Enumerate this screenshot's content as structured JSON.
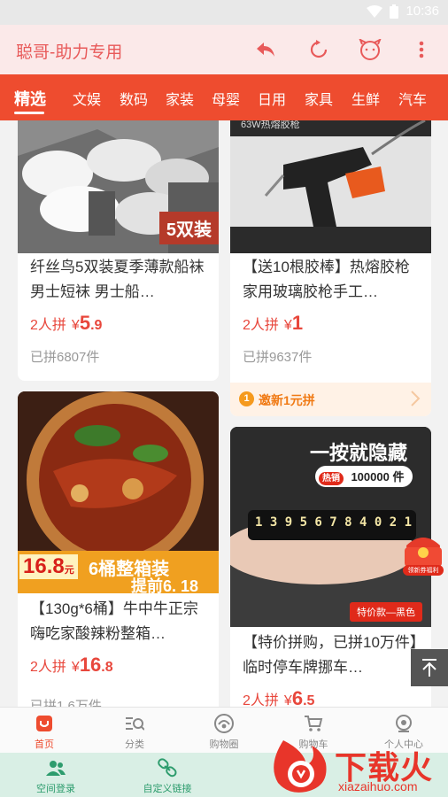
{
  "status_bar": {
    "time": "10:36"
  },
  "app_bar": {
    "title": "聪哥-助力专用"
  },
  "tabs": [
    {
      "label": "精选"
    },
    {
      "label": "文娱"
    },
    {
      "label": "数码"
    },
    {
      "label": "家装"
    },
    {
      "label": "母婴"
    },
    {
      "label": "日用"
    },
    {
      "label": "家具"
    },
    {
      "label": "生鲜"
    },
    {
      "label": "汽车"
    }
  ],
  "products": [
    {
      "image_badge": "5双装",
      "name": "纤丝鸟5双装夏季薄款船袜男士短袜 男士船…",
      "group": "2人拼",
      "currency": "¥",
      "price_int": "5",
      "price_dec": ".9",
      "sold": "已拼6807件"
    },
    {
      "image_caption": "63W热熔胶枪",
      "name": "【送10根胶棒】热熔胶枪家用玻璃胶枪手工…",
      "group": "2人拼",
      "currency": "¥",
      "price_int": "1",
      "price_dec": "",
      "sold": "已拼9637件",
      "promo_icon": "1",
      "promo": "邀新1元拼"
    },
    {
      "image_price": "16.8",
      "image_price_unit": "元",
      "image_banner": "6桶整箱装",
      "image_banner2": "提前6. 18",
      "name": "【130g*6桶】牛中牛正宗嗨吃家酸辣粉整箱…",
      "group": "2人拼",
      "currency": "¥",
      "price_int": "16",
      "price_dec": ".8",
      "sold": "已拼1.6万件"
    },
    {
      "image_headline": "一按就隐藏",
      "image_hot": "热销",
      "image_count": "100000 件",
      "image_plate": "1 3 9 5 6 7 8 4 0 2 1",
      "image_tag": "特价款—黑色",
      "name": "【特价拼购，已拼10万件】临时停车牌挪车…",
      "group": "2人拼",
      "currency": "¥",
      "price_int": "6",
      "price_dec": ".5",
      "sold": ""
    }
  ],
  "red_packet": {
    "label": "领新券福利"
  },
  "bottom_nav": [
    {
      "label": "首页",
      "icon": "home-icon"
    },
    {
      "label": "分类",
      "icon": "category-icon"
    },
    {
      "label": "购物圈",
      "icon": "community-icon"
    },
    {
      "label": "购物车",
      "icon": "cart-icon"
    },
    {
      "label": "个人中心",
      "icon": "profile-icon"
    }
  ],
  "toolbar": [
    {
      "label": "空间登录",
      "icon": "users-icon"
    },
    {
      "label": "自定义链接",
      "icon": "link-icon"
    }
  ],
  "watermark": {
    "brand": "下载火",
    "domain": "xiazaihuo.com"
  },
  "colors": {
    "accent": "#ee4c2f",
    "price": "#e8473c",
    "promo": "#f07a14",
    "toolbar": "#2d9c6d"
  }
}
